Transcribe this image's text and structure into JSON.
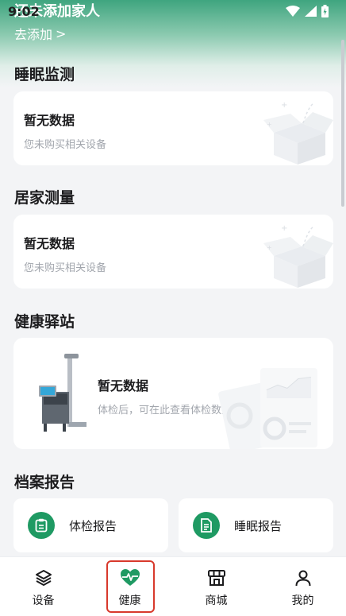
{
  "status_bar": {
    "time": "9:02"
  },
  "family": {
    "title": "还未添加家人",
    "add_label": "去添加",
    "chevron": ">"
  },
  "sections": {
    "sleep": {
      "title": "睡眠监测",
      "card_title": "暂无数据",
      "card_sub": "您未购买相关设备"
    },
    "home": {
      "title": "居家测量",
      "card_title": "暂无数据",
      "card_sub": "您未购买相关设备"
    },
    "station": {
      "title": "健康驿站",
      "card_title": "暂无数据",
      "card_sub": "体检后，可在此查看体检数据"
    },
    "reports": {
      "title": "档案报告",
      "items": [
        {
          "label": "体检报告",
          "icon": "clipboard-icon"
        },
        {
          "label": "睡眠报告",
          "icon": "document-icon"
        }
      ]
    }
  },
  "tabs": [
    {
      "label": "设备",
      "icon": "layers-icon",
      "active": false
    },
    {
      "label": "健康",
      "icon": "heart-pulse-icon",
      "active": true
    },
    {
      "label": "商城",
      "icon": "store-icon",
      "active": false
    },
    {
      "label": "我的",
      "icon": "user-icon",
      "active": false
    }
  ],
  "colors": {
    "accent": "#1f9a63",
    "header_gradient_top": "#3fa57f",
    "background": "#f3f4f6",
    "highlight_frame": "#d8392c"
  }
}
